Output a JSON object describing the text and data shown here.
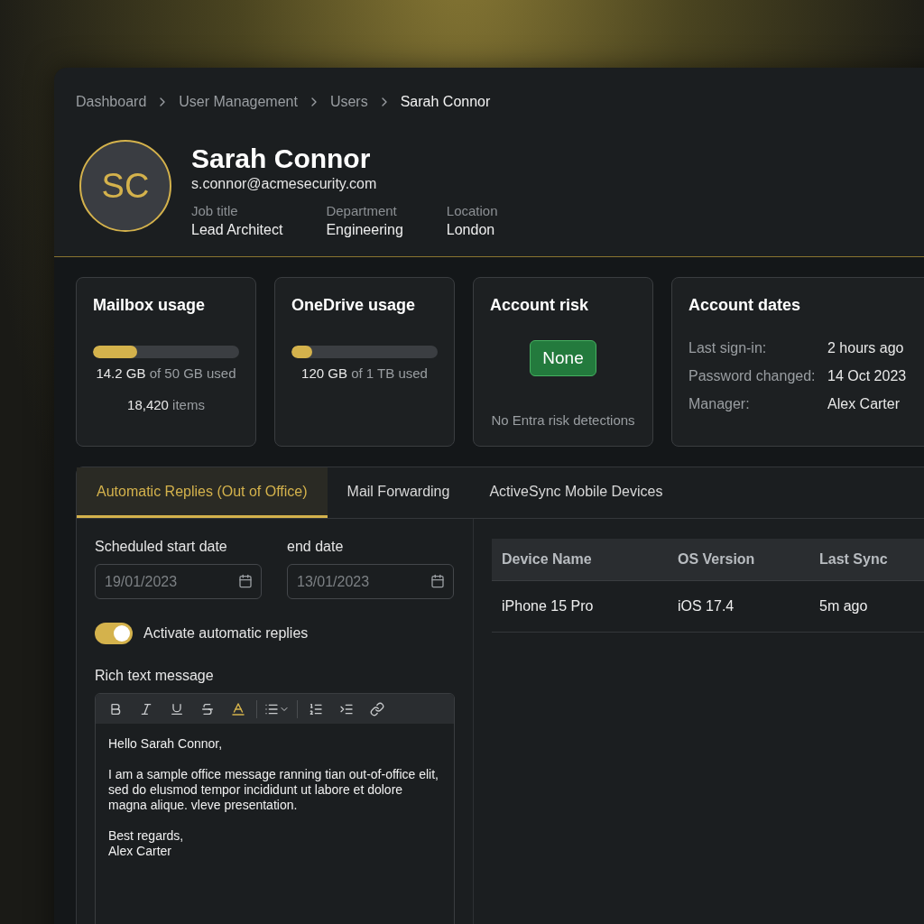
{
  "breadcrumb": [
    {
      "label": "Dashboard",
      "current": false
    },
    {
      "label": "User Management",
      "current": false
    },
    {
      "label": "Users",
      "current": false
    },
    {
      "label": "Sarah Connor",
      "current": true
    }
  ],
  "profile": {
    "initials": "SC",
    "name": "Sarah Connor",
    "email": "s.connor@acmesecurity.com",
    "fields": [
      {
        "label": "Job title",
        "value": "Lead Architect"
      },
      {
        "label": "Department",
        "value": "Engineering"
      },
      {
        "label": "Location",
        "value": "London"
      }
    ]
  },
  "cards": [
    {
      "kind": "usage",
      "title": "Mailbox usage",
      "level": 0.3,
      "used": "14.2 GB",
      "total": "of 50 GB used",
      "count": "18,420",
      "count_label": "items"
    },
    {
      "kind": "usage",
      "title": "OneDrive usage",
      "level": 0.14,
      "used": "120 GB",
      "total": "of 1 TB used"
    },
    {
      "kind": "risk",
      "title": "Account risk",
      "badge": "None",
      "note": "No Entra risk detections"
    },
    {
      "kind": "dates",
      "title": "Account dates",
      "rows": [
        {
          "label": "Last sign-in:",
          "value": "2 hours ago"
        },
        {
          "label": "Password changed:",
          "value": "14 Oct 2023"
        },
        {
          "label": "Manager:",
          "value": "Alex Carter"
        }
      ]
    }
  ],
  "tabs": [
    {
      "label": "Automatic Replies (Out of Office)",
      "selected": true
    },
    {
      "label": "Mail Forwarding",
      "selected": false
    },
    {
      "label": "ActiveSync Mobile Devices",
      "selected": false
    }
  ],
  "auto_replies": {
    "start": {
      "label": "Scheduled start date",
      "placeholder": "19/01/2023"
    },
    "end": {
      "label": "end date",
      "placeholder": "13/01/2023"
    },
    "toggle": {
      "label": "Activate automatic replies",
      "on": true
    },
    "editor_label": "Rich text message",
    "message": [
      "Hello Sarah Connor,",
      "I am a sample office message ranning tian out-of-office elit, sed do elusmod tempor incididunt ut labore et dolore magna alique. vleve presentation.",
      "Best regards,\nAlex Carter"
    ]
  },
  "devices": {
    "columns": [
      "Device Name",
      "OS Version",
      "Last Sync"
    ],
    "rows": [
      [
        "iPhone 15 Pro",
        "iOS 17.4",
        "5m ago"
      ]
    ]
  }
}
